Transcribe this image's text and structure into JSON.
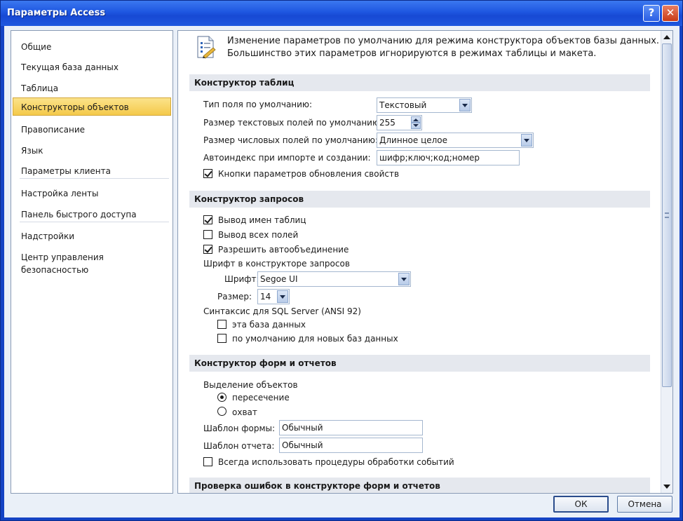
{
  "window": {
    "title": "Параметры Access",
    "help_glyph": "?",
    "close_glyph": "✕"
  },
  "nav": {
    "items": [
      {
        "label": "Общие"
      },
      {
        "label": "Текущая база данных"
      },
      {
        "label": "Таблица"
      },
      {
        "label": "Конструкторы объектов",
        "selected": true
      },
      {
        "label": "Правописание"
      },
      {
        "label": "Язык"
      },
      {
        "label": "Параметры клиента"
      },
      {
        "label": "Настройка ленты"
      },
      {
        "label": "Панель быстрого доступа"
      },
      {
        "label": "Надстройки"
      },
      {
        "label": "Центр управления безопасностью"
      }
    ]
  },
  "header": {
    "line1": "Изменение параметров по умолчанию для режима конструктора объектов базы данных.",
    "line2": "Большинство этих параметров игнорируются в режимах таблицы и макета."
  },
  "tables": {
    "section_title": "Конструктор таблиц",
    "field_type_label": "Тип поля по умолчанию:",
    "field_type_value": "Текстовый",
    "text_size_label": "Размер текстовых полей по умолчанию:",
    "text_size_value": "255",
    "num_size_label": "Размер числовых полей по умолчанию:",
    "num_size_value": "Длинное целое",
    "autoindex_label": "Автоиндекс при импорте и создании:",
    "autoindex_value": "шифр;ключ;код;номер",
    "update_opts_label": "Кнопки параметров обновления свойств",
    "update_opts_checked": true
  },
  "queries": {
    "section_title": "Конструктор запросов",
    "show_table_names_label": "Вывод имен таблиц",
    "show_table_names_checked": true,
    "output_all_fields_label": "Вывод всех полей",
    "output_all_fields_checked": false,
    "autojoin_label": "Разрешить автообъединение",
    "autojoin_checked": true,
    "font_group_label": "Шрифт в конструкторе запросов",
    "font_label": "Шрифт:",
    "font_value": "Segoe UI",
    "size_label": "Размер:",
    "size_value": "14",
    "sql_label": "Синтаксис для SQL Server (ANSI 92)",
    "this_db_label": "эта база данных",
    "this_db_checked": false,
    "default_new_label": "по умолчанию для новых баз данных",
    "default_new_checked": false
  },
  "forms": {
    "section_title": "Конструктор форм и отчетов",
    "selection_label": "Выделение объектов",
    "partial_label": "пересечение",
    "partial_selected": true,
    "full_label": "охват",
    "full_selected": false,
    "form_template_label": "Шаблон формы:",
    "form_template_value": "Обычный",
    "report_template_label": "Шаблон отчета:",
    "report_template_value": "Обычный",
    "always_events_label": "Всегда использовать процедуры обработки событий",
    "always_events_checked": false
  },
  "errors": {
    "section_title": "Проверка ошибок в конструкторе форм и отчетов"
  },
  "footer": {
    "ok_label": "ОК",
    "cancel_label": "Отмена"
  }
}
